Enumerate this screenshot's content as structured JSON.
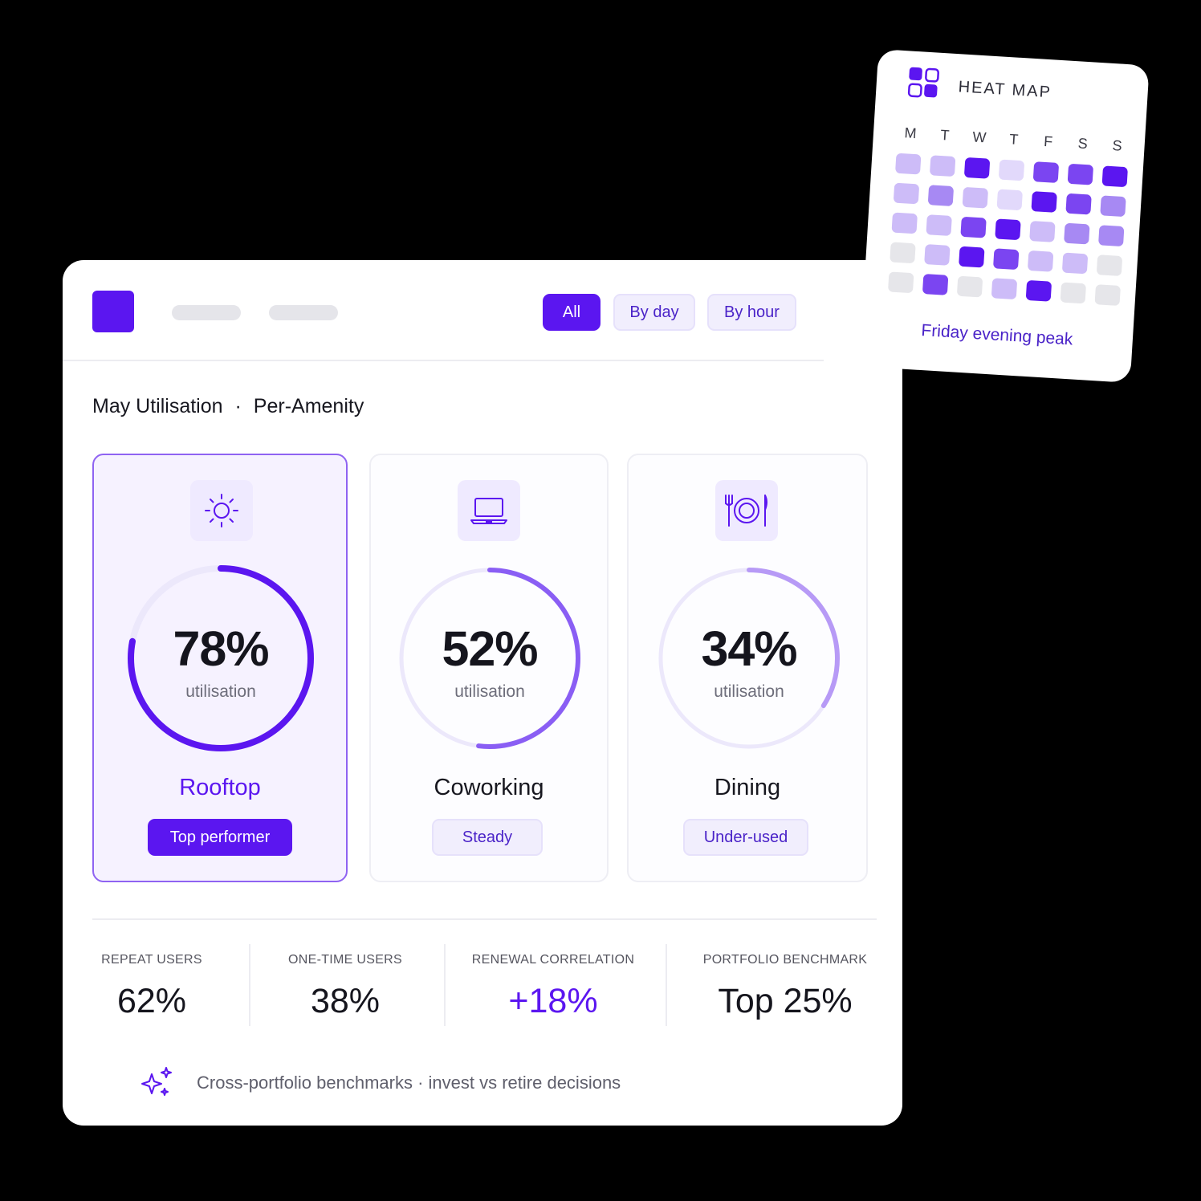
{
  "filters": {
    "all": "All",
    "by_day": "By day",
    "by_hour": "By hour"
  },
  "section": {
    "title": "May Utilisation",
    "separator": "·",
    "subtitle": "Per-Amenity"
  },
  "amenities": [
    {
      "name": "Rooftop",
      "utilisation_percent": 78,
      "value": "78%",
      "caption": "utilisation",
      "badge": "Top performer",
      "icon": "sun-icon"
    },
    {
      "name": "Coworking",
      "utilisation_percent": 52,
      "value": "52%",
      "caption": "utilisation",
      "badge": "Steady",
      "icon": "laptop-icon"
    },
    {
      "name": "Dining",
      "utilisation_percent": 34,
      "value": "34%",
      "caption": "utilisation",
      "badge": "Under-used",
      "icon": "plate-cutlery-icon"
    }
  ],
  "stats": [
    {
      "label": "REPEAT USERS",
      "value": "62%"
    },
    {
      "label": "ONE-TIME USERS",
      "value": "38%"
    },
    {
      "label": "RENEWAL CORRELATION",
      "value": "+18%"
    },
    {
      "label": "PORTFOLIO BENCHMARK",
      "value": "Top 25%"
    }
  ],
  "footnote": {
    "text": "Cross-portfolio benchmarks  ·  invest vs retire decisions",
    "icon": "sparkles-icon"
  },
  "heatmap": {
    "title": "HEAT MAP",
    "icon": "grid-icon",
    "days": [
      "M",
      "T",
      "W",
      "T",
      "F",
      "S",
      "S"
    ],
    "intensity_grid": [
      [
        1,
        1,
        4,
        0.5,
        3,
        3,
        4
      ],
      [
        1,
        2,
        1,
        0.5,
        4,
        3,
        2
      ],
      [
        1,
        1,
        3,
        4,
        1,
        2,
        2
      ],
      [
        0,
        1,
        4,
        3,
        1,
        1,
        0
      ],
      [
        0,
        3,
        0,
        1,
        4,
        0,
        0
      ]
    ],
    "caption": "Friday evening peak"
  },
  "colors": {
    "accent": "#5b16f0",
    "accent_soft": "#f1eefd",
    "ring_track": "#ece8fb"
  }
}
